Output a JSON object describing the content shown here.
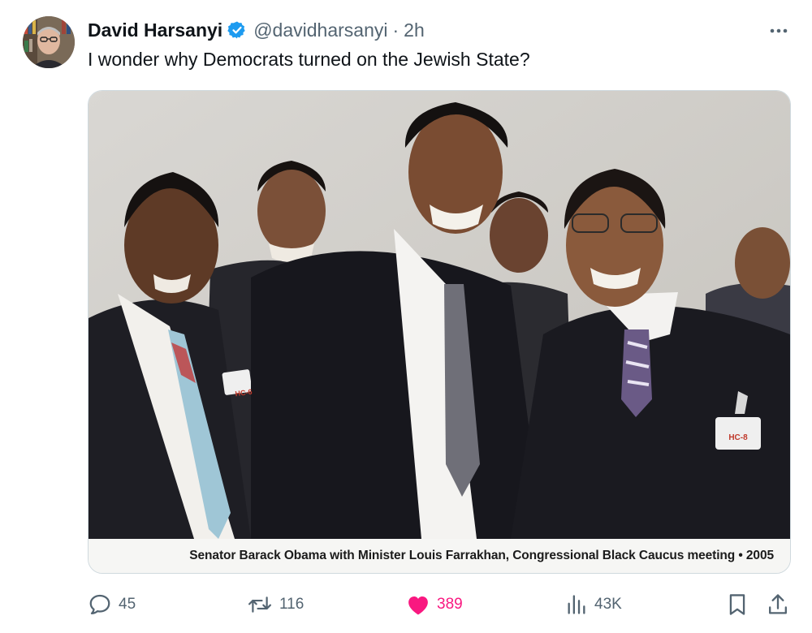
{
  "tweet": {
    "author": {
      "display_name": "David Harsanyi",
      "handle": "@davidharsanyi",
      "separator": "·",
      "time": "2h",
      "verified": true
    },
    "text": "I wonder why Democrats turned on the Jewish State?",
    "media": {
      "caption": "Senator Barack Obama with Minister Louis Farrakhan, Congressional Black Caucus meeting • 2005",
      "badges": [
        "HC-6",
        "HC-8"
      ]
    },
    "actions": {
      "replies": "45",
      "reposts": "116",
      "likes": "389",
      "views": "43K"
    },
    "colors": {
      "like_active": "#f91880",
      "verified_blue": "#1d9bf0",
      "secondary_text": "#536471"
    },
    "icons": {
      "more": "more-horizontal-icon",
      "reply": "speech-bubble-icon",
      "repost": "repost-arrows-icon",
      "like": "heart-filled-icon",
      "views": "bar-chart-icon",
      "bookmark": "bookmark-icon",
      "share": "share-upload-icon"
    }
  }
}
